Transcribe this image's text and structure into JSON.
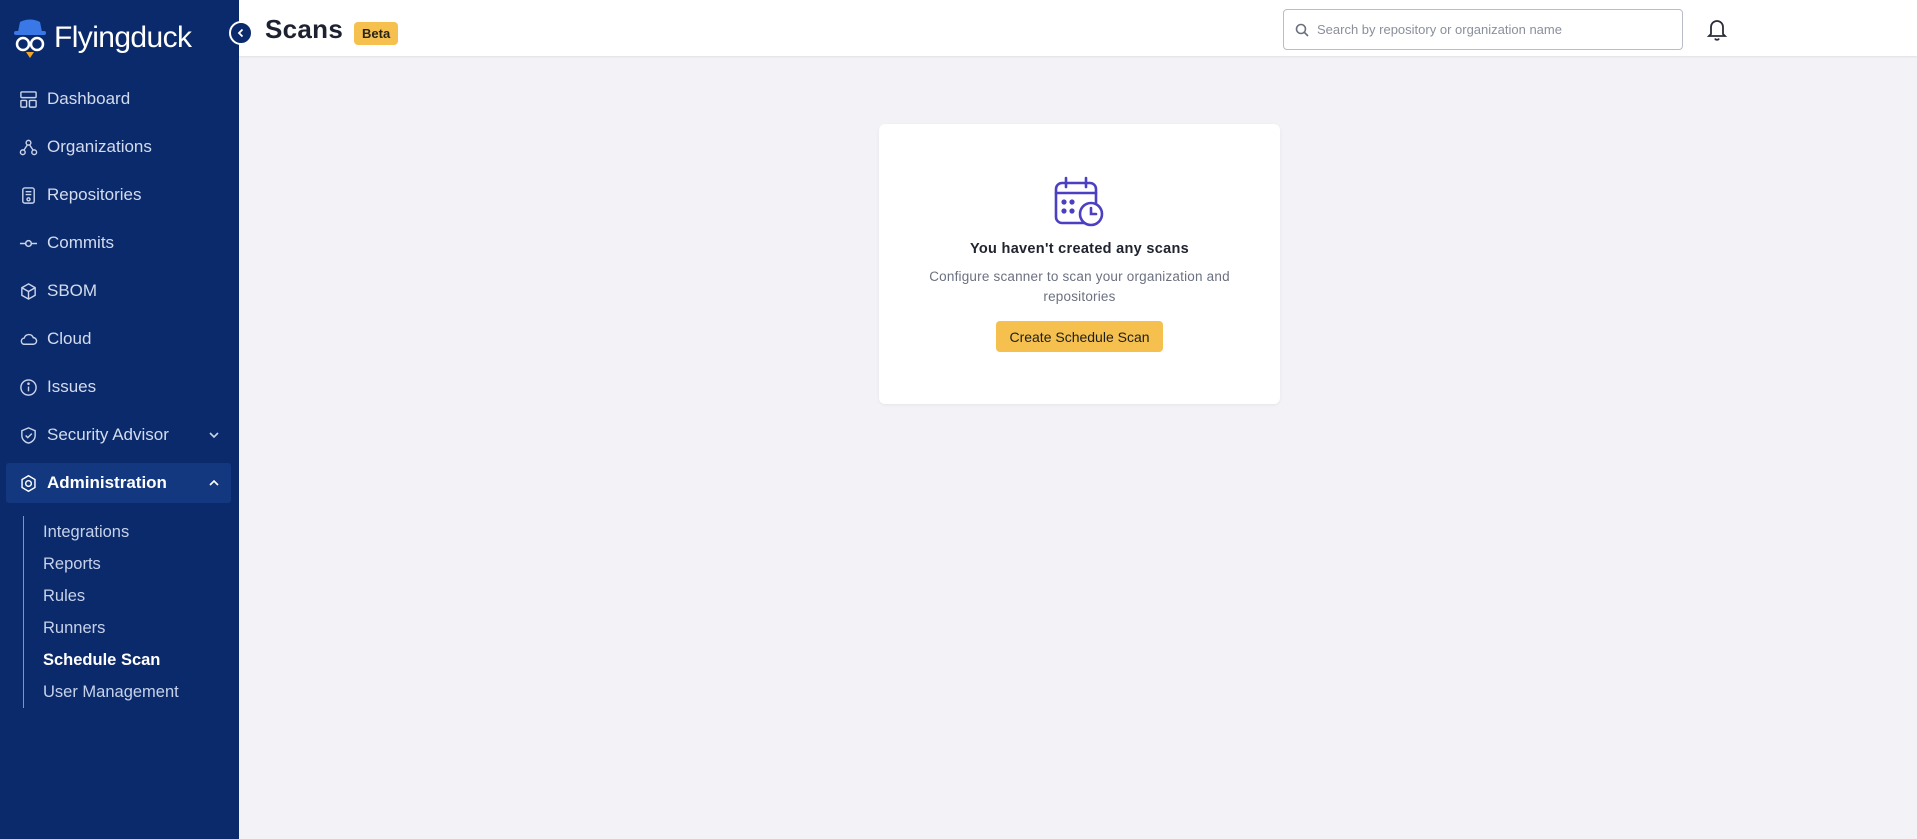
{
  "app": {
    "name": "Flyingduck"
  },
  "sidebar": {
    "items": [
      {
        "label": "Dashboard",
        "icon": "dashboard-icon"
      },
      {
        "label": "Organizations",
        "icon": "org-tree-icon"
      },
      {
        "label": "Repositories",
        "icon": "repository-icon"
      },
      {
        "label": "Commits",
        "icon": "commit-icon"
      },
      {
        "label": "SBOM",
        "icon": "cube-icon"
      },
      {
        "label": "Cloud",
        "icon": "cloud-icon"
      },
      {
        "label": "Issues",
        "icon": "info-circle-icon"
      },
      {
        "label": "Security Advisor",
        "icon": "shield-check-icon",
        "expandable": true,
        "expanded": false
      },
      {
        "label": "Administration",
        "icon": "gear-icon",
        "expandable": true,
        "expanded": true,
        "active": true
      }
    ],
    "admin_subitems": [
      {
        "label": "Integrations"
      },
      {
        "label": "Reports"
      },
      {
        "label": "Rules"
      },
      {
        "label": "Runners"
      },
      {
        "label": "Schedule Scan",
        "active": true
      },
      {
        "label": "User Management"
      }
    ]
  },
  "header": {
    "title": "Scans",
    "badge": "Beta",
    "search": {
      "placeholder": "Search by repository or organization name",
      "value": ""
    }
  },
  "empty_state": {
    "icon": "calendar-clock-icon",
    "title": "You haven't created any scans",
    "description": "Configure scanner to scan your organization and repositories",
    "button_label": "Create Schedule Scan"
  },
  "colors": {
    "sidebar_bg": "#0b2a6b",
    "accent": "#f5c04d",
    "page_bg": "#f2f2f7",
    "icon_purple": "#4b3fc2"
  }
}
